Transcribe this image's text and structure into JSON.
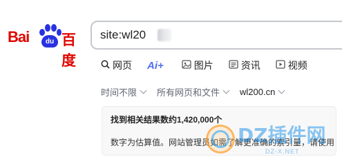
{
  "logo": {
    "part1": "Bai",
    "paw_text": "du",
    "part2": "百度"
  },
  "search": {
    "query": "site:wl20"
  },
  "tabs": [
    {
      "label": "网页",
      "icon": "search-icon"
    },
    {
      "label": "Ai+",
      "icon": "ai-sparkle-icon"
    },
    {
      "label": "图片",
      "icon": "image-icon"
    },
    {
      "label": "资讯",
      "icon": "news-icon"
    },
    {
      "label": "视频",
      "icon": "video-icon"
    }
  ],
  "filters": [
    {
      "label": "时间不限"
    },
    {
      "label": "所有网页和文件"
    },
    {
      "label": "wl200.cn"
    }
  ],
  "result": {
    "count_text": "找到相关结果数约1,420,000个",
    "note_text": "数字为估算值。网站管理员如需了解更准确的索引量，请使用"
  },
  "watermark": {
    "text": "DZ插件网",
    "sub": "DZ-X.NET"
  },
  "colors": {
    "brand_red": "#e10601",
    "brand_blue": "#2932e1",
    "accent": "#4e6ef2"
  }
}
